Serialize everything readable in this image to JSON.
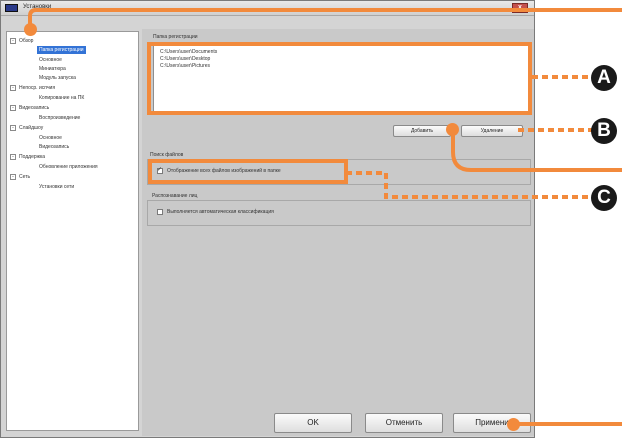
{
  "window": {
    "title": "Установки",
    "close_label": "x"
  },
  "tree": {
    "items": [
      {
        "label": "Обзор",
        "level": 0,
        "expander": "-"
      },
      {
        "label": "Папка регистрации",
        "level": 1,
        "selected": true
      },
      {
        "label": "Основное",
        "level": 1
      },
      {
        "label": "Миниатюра",
        "level": 1
      },
      {
        "label": "Модуль запуска",
        "level": 1
      },
      {
        "label": "Непоср. испчия",
        "level": 0,
        "expander": "-"
      },
      {
        "label": "Копирование на ПК",
        "level": 1
      },
      {
        "label": "Видеозапись",
        "level": 0,
        "expander": "-"
      },
      {
        "label": "Воспроизведение",
        "level": 1
      },
      {
        "label": "Слайдшоу",
        "level": 0,
        "expander": "-"
      },
      {
        "label": "Основное",
        "level": 1
      },
      {
        "label": "Видеозапись",
        "level": 1
      },
      {
        "label": "Поддержка",
        "level": 0,
        "expander": "-"
      },
      {
        "label": "Обновление приложения",
        "level": 1
      },
      {
        "label": "Сеть",
        "level": 0,
        "expander": "-"
      },
      {
        "label": "Установки сети",
        "level": 1
      }
    ]
  },
  "registration": {
    "label": "Папка регистрации",
    "paths": [
      "C:\\Users\\user\\Documents",
      "C:\\Users\\user\\Desktop",
      "C:\\Users\\user\\Pictures"
    ],
    "add_button": "Добавить",
    "remove_button": "Удаление"
  },
  "file_search": {
    "label": "Поиск файлов",
    "checkbox_label": "Отображение всех файлов изображений в папке",
    "checked": true
  },
  "face_recognition": {
    "label": "Распознавание лиц",
    "checkbox_label": "Выполняется автоматическая классификация",
    "checked": false
  },
  "footer": {
    "ok": "OK",
    "cancel": "Отменить",
    "apply": "Примени"
  },
  "callouts": {
    "a": "A",
    "b": "B",
    "c": "C"
  },
  "colors": {
    "callout": "#f28a3c",
    "selection": "#3373d6",
    "badge": "#1a1a1a"
  }
}
